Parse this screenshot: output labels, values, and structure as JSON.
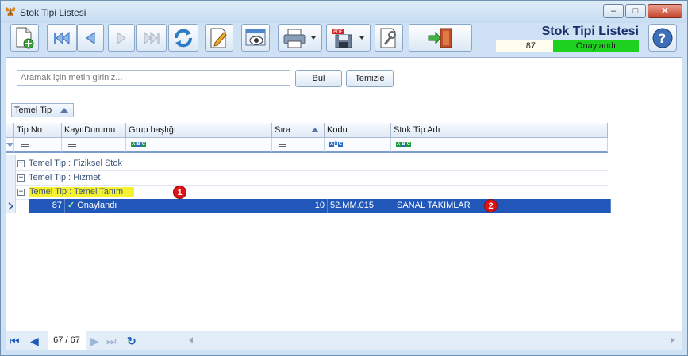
{
  "window": {
    "title": "Stok Tipi Listesi",
    "minimize_icon": "minimize-icon",
    "maximize_icon": "maximize-icon",
    "close_icon": "close-icon"
  },
  "toolbar": {
    "title": "Stok Tipi Listesi",
    "record_id": "87",
    "status": "Onaylandı",
    "status_color": "#1ed11e",
    "icons": [
      "new-document-icon",
      "first-record-icon",
      "previous-record-icon",
      "next-record-icon",
      "last-record-icon",
      "refresh-icon",
      "edit-icon",
      "preview-icon",
      "print-icon",
      "export-pdf-icon",
      "settings-icon",
      "exit-door-icon",
      "help-icon"
    ]
  },
  "search": {
    "placeholder": "Aramak için metin giriniz...",
    "find_label": "Bul",
    "clear_label": "Temizle"
  },
  "grouping": {
    "chip_label": "Temel Tip"
  },
  "grid": {
    "columns": [
      "Tip No",
      "KayıtDurumu",
      "Grup başlığı",
      "Sıra",
      "Kodu",
      "Stok Tip Adı"
    ],
    "groups": [
      {
        "label": "Temel Tip : Fiziksel Stok",
        "expanded": false
      },
      {
        "label": "Temel Tip : Hizmet",
        "expanded": false
      },
      {
        "label": "Temel Tip : Temel Tanım",
        "expanded": true
      }
    ],
    "rows": [
      {
        "tip_no": "87",
        "kayit_durumu": "Onaylandı",
        "grup_basligi": "",
        "sira": "10",
        "kodu": "52.MM.015",
        "stok_tip_adi": "SANAL TAKIMLAR"
      }
    ],
    "selection_color": "#2057b8"
  },
  "annotations": {
    "badge1": "1",
    "badge2": "2"
  },
  "navigator": {
    "position": "67 / 67"
  }
}
